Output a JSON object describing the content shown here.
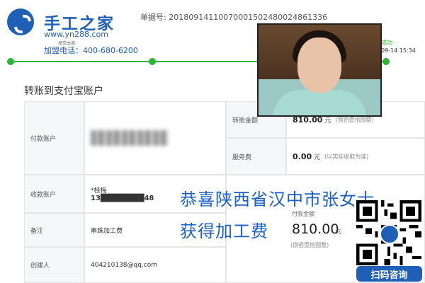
{
  "brand": {
    "title": "手工之家",
    "url": "www.yn288.com",
    "tiny": "择交由诺",
    "phone": "加盟电话：400-680-6200"
  },
  "receipt": {
    "number": "单据号: 20180914110070001502480024861336"
  },
  "progress": {
    "status": "成功",
    "date": "09-14 15:34"
  },
  "section": {
    "title": "转账到支付宝账户"
  },
  "table": {
    "payer_label": "付款账户",
    "payee_label": "收款账户",
    "payee_name": "*桂梅",
    "payee_account": "13████████48",
    "note_label": "备注",
    "note_value": "串珠加工费",
    "creator_label": "创建人",
    "creator_value": "404210138@qq.com",
    "amount_label": "转账金额",
    "amount_value": "810.00",
    "amount_unit": "元",
    "amount_hint": "(捌佰壹拾圆整)",
    "fee_label": "服务费",
    "fee_value": "0.00",
    "fee_unit": "元",
    "fee_hint": "(以实际收取为准)"
  },
  "announcement": {
    "line1": "恭喜陕西省汉中市张女士",
    "line2": "获得加工费",
    "pay_label": "付款金额",
    "pay_amount": "810.00",
    "pay_unit": "元",
    "pay_hint": "(捌佰壹拾圆整)"
  },
  "qr": {
    "button": "扫码咨询"
  }
}
